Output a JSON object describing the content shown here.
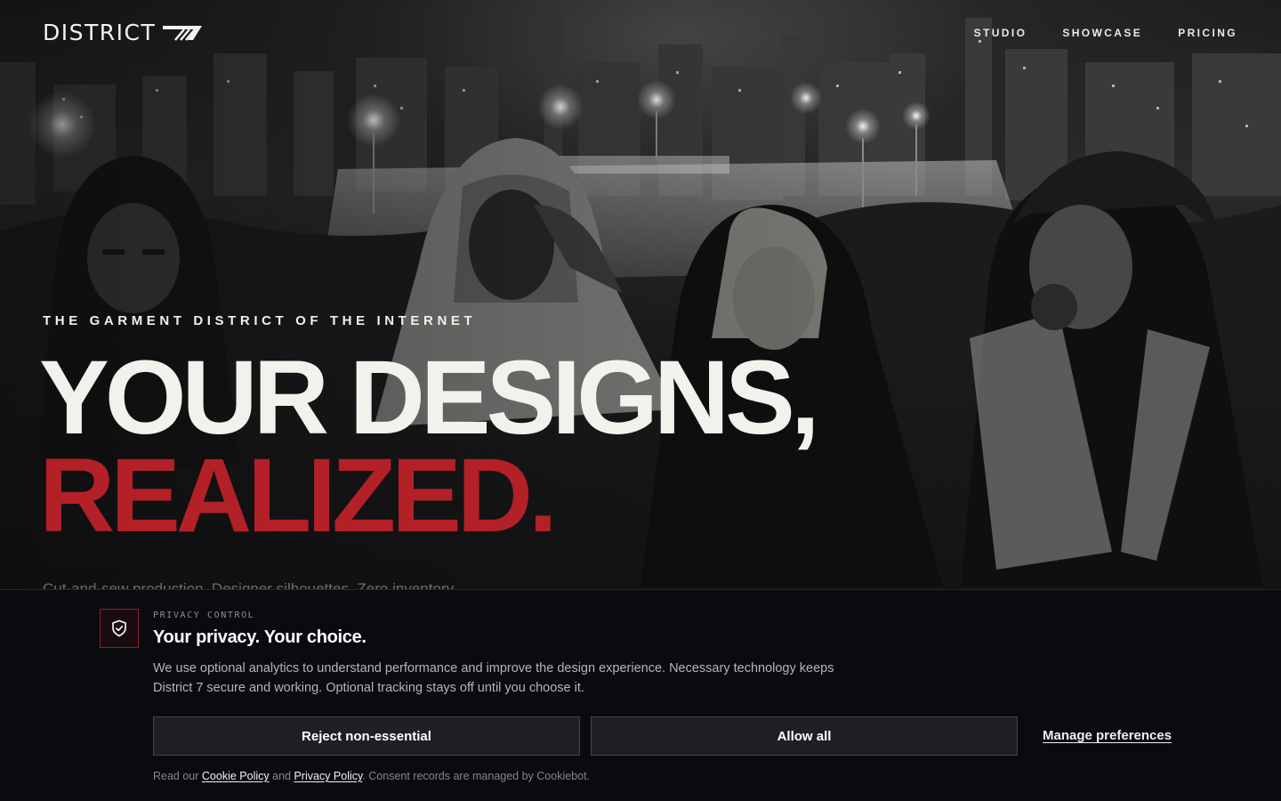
{
  "header": {
    "logo_text": "DISTRICT",
    "logo_mark": "7-slash-mark",
    "nav": [
      {
        "label": "STUDIO"
      },
      {
        "label": "SHOWCASE"
      },
      {
        "label": "PRICING"
      }
    ]
  },
  "hero": {
    "eyebrow": "THE GARMENT DISTRICT OF THE INTERNET",
    "headline_line1": "YOUR DESIGNS,",
    "headline_line2": "REALIZED.",
    "subtext": "Cut-and-sew production. Designer silhouettes. Zero inventory.",
    "background": "black-and-white night city photo with four hooded figures"
  },
  "consent": {
    "icon": "shield-check-icon",
    "eyebrow": "PRIVACY CONTROL",
    "title": "Your privacy. Your choice.",
    "body": "We use optional analytics to understand performance and improve the design experience. Necessary technology keeps District 7 secure and working. Optional tracking stays off until you choose it.",
    "reject_label": "Reject non-essential",
    "allow_label": "Allow all",
    "manage_label": "Manage preferences",
    "footer": {
      "prefix": "Read our ",
      "cookie_link": "Cookie Policy",
      "middle": " and ",
      "privacy_link": "Privacy Policy",
      "suffix": ". Consent records are managed by Cookiebot."
    }
  },
  "colors": {
    "accent_red": "#b32027",
    "headline_white": "#f2f1eb",
    "banner_bg": "#0a0b0e",
    "button_bg": "#1f2024"
  }
}
